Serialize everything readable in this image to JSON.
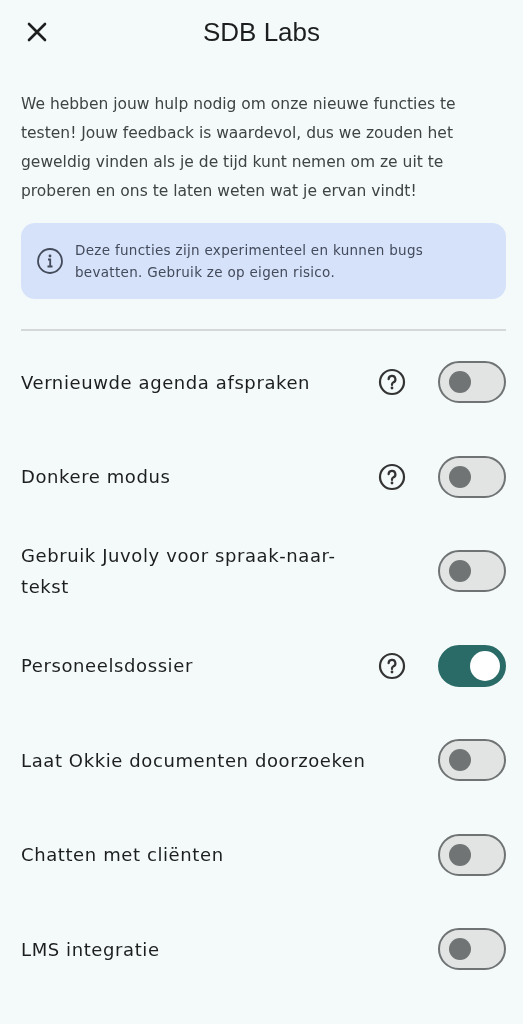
{
  "header": {
    "title": "SDB Labs"
  },
  "intro": "We hebben jouw hulp nodig om onze nieuwe functies te testen! Jouw feedback is waardevol, dus we zouden het geweldig vinden als je de tijd kunt nemen om ze uit te proberen en ons te laten weten wat je ervan vindt!",
  "notice": "Deze functies zijn experimenteel en kunnen bugs bevatten. Gebruik ze op eigen risico.",
  "features": [
    {
      "label": "Vernieuwde agenda afspraken",
      "help": true,
      "on": false
    },
    {
      "label": "Donkere modus",
      "help": true,
      "on": false
    },
    {
      "label": "Gebruik Juvoly voor spraak-naar-tekst",
      "help": false,
      "on": false
    },
    {
      "label": "Personeelsdossier",
      "help": true,
      "on": true
    },
    {
      "label": "Laat Okkie documenten doorzoeken",
      "help": false,
      "on": false
    },
    {
      "label": "Chatten met cliënten",
      "help": false,
      "on": false
    },
    {
      "label": "LMS integratie",
      "help": false,
      "on": false
    }
  ]
}
